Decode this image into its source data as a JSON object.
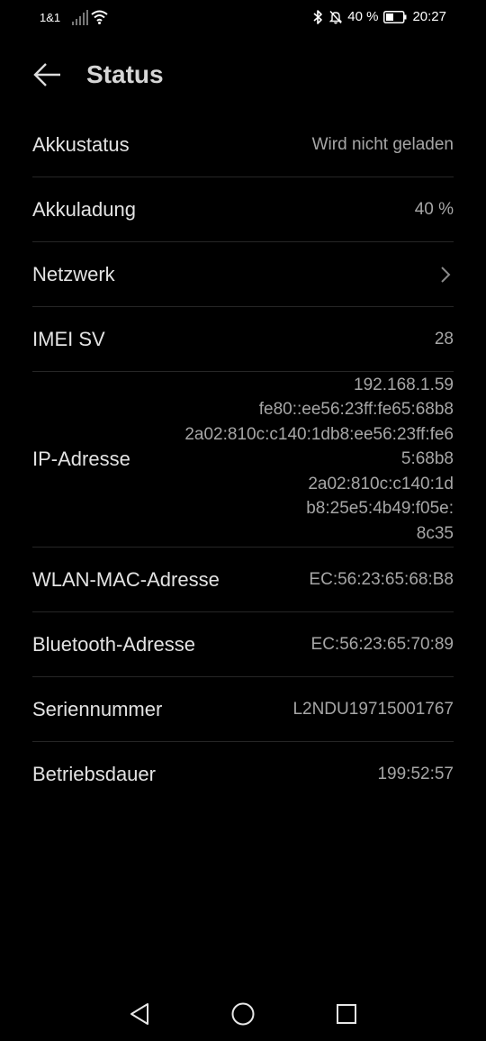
{
  "status_bar": {
    "carrier": "1&1",
    "battery_percent": "40 %",
    "time": "20:27"
  },
  "header": {
    "title": "Status"
  },
  "rows": [
    {
      "label": "Akkustatus",
      "value": "Wird nicht geladen"
    },
    {
      "label": "Akkuladung",
      "value": "40 %"
    },
    {
      "label": "Netzwerk"
    },
    {
      "label": "IMEI SV",
      "value": "28"
    },
    {
      "label": "IP-Adresse",
      "lines": [
        "192.168.1.59",
        "fe80::ee56:23ff:fe65:68b8",
        "2a02:810c:c140:1db8:ee56:23ff:fe6",
        "5:68b8",
        "2a02:810c:c140:1d",
        "b8:25e5:4b49:f05e:",
        "8c35"
      ]
    },
    {
      "label": "WLAN-MAC-Adresse",
      "value": "EC:56:23:65:68:B8"
    },
    {
      "label": "Bluetooth-Adresse",
      "value": "EC:56:23:65:70:89"
    },
    {
      "label": "Seriennummer",
      "value": "L2NDU19715001767"
    },
    {
      "label": "Betriebsdauer",
      "value": "199:52:57"
    }
  ],
  "icons": {
    "signal": "signal-icon",
    "wifi": "wifi-icon",
    "bluetooth": "bluetooth-icon",
    "mute": "bell-off-icon",
    "battery": "battery-icon",
    "back": "arrow-left-icon",
    "chevron": "chevron-right-icon",
    "nav_back": "triangle-back-icon",
    "nav_home": "circle-home-icon",
    "nav_recent": "square-recent-icon"
  },
  "colors": {
    "background": "#000000",
    "label": "#e3e3e3",
    "value": "#a6a6a6",
    "divider": "#262626"
  }
}
